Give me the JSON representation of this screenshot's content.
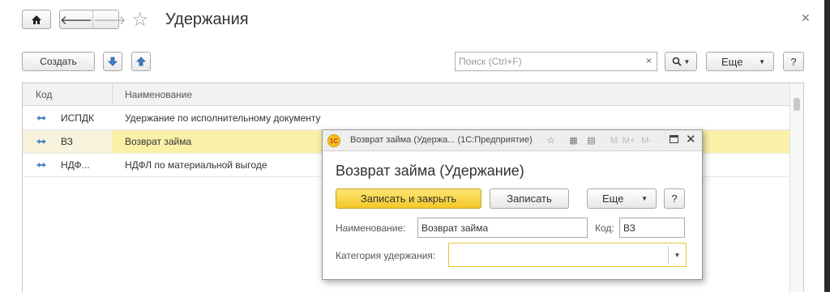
{
  "window": {
    "title": "Удержания"
  },
  "toolbar": {
    "create_label": "Создать",
    "search_placeholder": "Поиск (Ctrl+F)",
    "search_clear": "×",
    "more_label": "Еще",
    "help_label": "?"
  },
  "table": {
    "columns": [
      "Код",
      "Наименование"
    ],
    "rows": [
      {
        "code": "ИСПДК",
        "name": "Удержание по исполнительному документу",
        "selected": false
      },
      {
        "code": "ВЗ",
        "name": "Возврат займа",
        "selected": true
      },
      {
        "code": "НДФ...",
        "name": "НДФЛ по материальной выгоде",
        "selected": false
      }
    ]
  },
  "dialog": {
    "window_title": "Возврат займа (Удержа...  (1С:Предприятие)",
    "logo_text": "1С",
    "toolbar_icons": [
      "M",
      "M+",
      "M-"
    ],
    "heading": "Возврат займа (Удержание)",
    "save_close_label": "Записать и закрыть",
    "save_label": "Записать",
    "more_label": "Еще",
    "help_label": "?",
    "name_label": "Наименование:",
    "name_value": "Возврат займа",
    "code_label": "Код:",
    "code_value": "ВЗ",
    "category_label": "Категория удержания:",
    "category_value": ""
  },
  "colors": {
    "accent_yellow": "#f5c827",
    "selected_row": "#fbf0a8",
    "arrow_blue": "#2a6ab8"
  },
  "icons": [
    "home-icon",
    "back-arrow-icon",
    "forward-arrow-icon",
    "favorite-star-icon",
    "close-icon",
    "move-down-icon",
    "move-up-icon",
    "search-icon",
    "row-marker-icon",
    "logo-1c-icon",
    "favorite-icon",
    "calculator-icon",
    "calendar-icon",
    "maximize-icon",
    "chevron-down-icon"
  ]
}
